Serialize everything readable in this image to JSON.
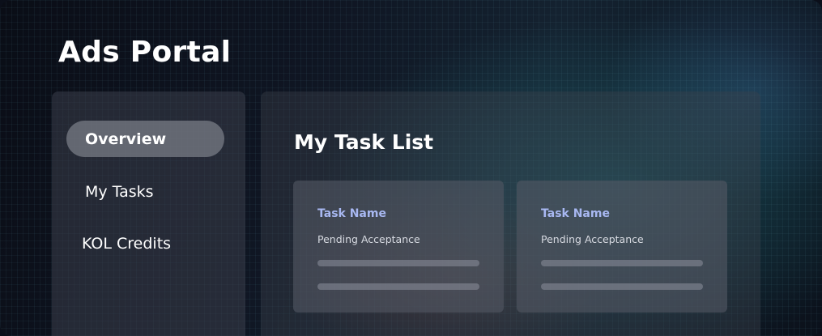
{
  "header": {
    "title": "Ads Portal"
  },
  "sidebar": {
    "items": [
      {
        "label": "Overview",
        "active": true
      },
      {
        "label": "My Tasks",
        "active": false
      },
      {
        "label": "KOL Credits",
        "active": false
      }
    ]
  },
  "main": {
    "title": "My Task List",
    "tasks": [
      {
        "name": "Task Name",
        "status": "Pending Acceptance"
      },
      {
        "name": "Task Name",
        "status": "Pending Acceptance"
      }
    ]
  },
  "colors": {
    "task_name": "#a8b8f2",
    "background": "#0b0f1a"
  }
}
